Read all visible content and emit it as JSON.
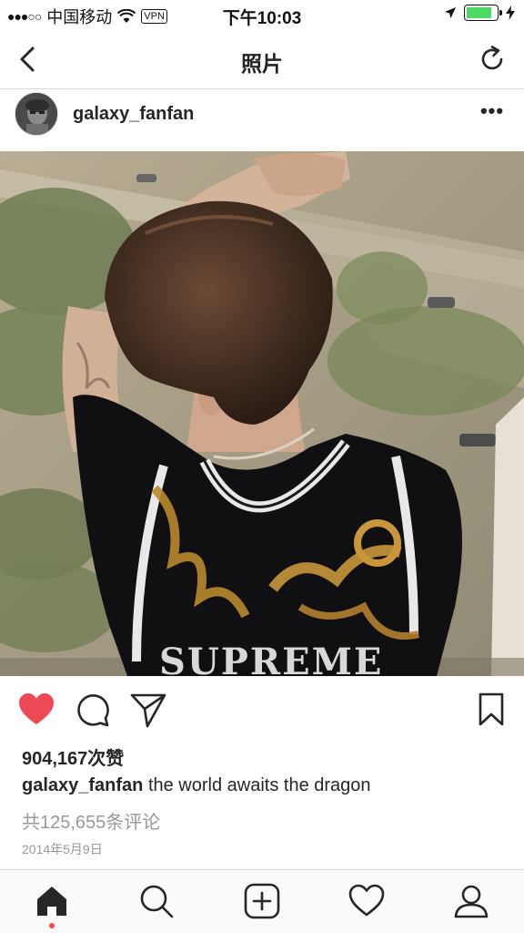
{
  "status_bar": {
    "signal": "●●●○○",
    "carrier": "中国移动",
    "vpn": "VPN",
    "time": "下午10:03",
    "battery_level": 0.85
  },
  "nav": {
    "title": "照片"
  },
  "post": {
    "username": "galaxy_fanfan",
    "more": "•••",
    "liked": true,
    "likes_text": "904,167次赞",
    "caption_user": "galaxy_fanfan",
    "caption_text": " the world awaits the dragon",
    "comments_text": "共125,655条评论",
    "date_text": "2014年5月9日"
  },
  "colors": {
    "like_red": "#ed4956",
    "battery_green": "#4cd964"
  },
  "icons": {
    "back": "chevron-left-icon",
    "refresh": "refresh-icon",
    "like": "heart-icon",
    "comment": "comment-icon",
    "share": "send-icon",
    "save": "bookmark-icon",
    "tabs": [
      "home-icon",
      "search-icon",
      "add-post-icon",
      "activity-heart-icon",
      "profile-icon"
    ]
  }
}
